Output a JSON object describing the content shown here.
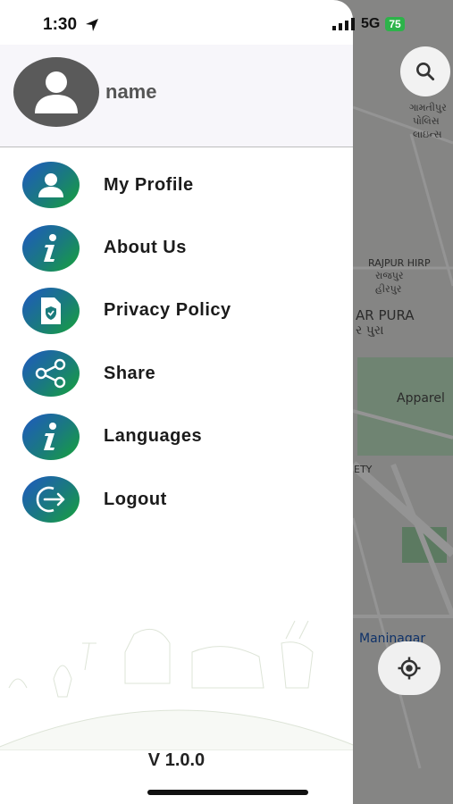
{
  "status_bar": {
    "time": "1:30",
    "network": "5G",
    "battery": "75"
  },
  "map": {
    "labels": [
      {
        "text": "ગામતીપુર"
      },
      {
        "text": "પોલિસ"
      },
      {
        "text": "લાઇન્સ"
      },
      {
        "text": "RAJPUR HIRP"
      },
      {
        "text": "રાજપુર"
      },
      {
        "text": "હીરપુર"
      },
      {
        "text": "AR PURA"
      },
      {
        "text": "ર પુરા"
      },
      {
        "text": "Apparel"
      },
      {
        "text": "ETY"
      },
      {
        "text": "Maninagar"
      }
    ],
    "search_icon": "search-icon",
    "location_icon": "my-location-icon"
  },
  "drawer": {
    "user_name": "name",
    "avatar_icon": "person-icon",
    "menu": [
      {
        "label": "My Profile",
        "icon": "person-icon"
      },
      {
        "label": "About Us",
        "icon": "info-icon"
      },
      {
        "label": "Privacy Policy",
        "icon": "shield-document-icon"
      },
      {
        "label": "Share",
        "icon": "share-icon"
      },
      {
        "label": "Languages",
        "icon": "info-icon"
      },
      {
        "label": "Logout",
        "icon": "logout-icon"
      }
    ],
    "version": "V 1.0.0"
  },
  "colors": {
    "accent_start": "#1f58c2",
    "accent_end": "#17a23a",
    "battery": "#2db34a"
  }
}
